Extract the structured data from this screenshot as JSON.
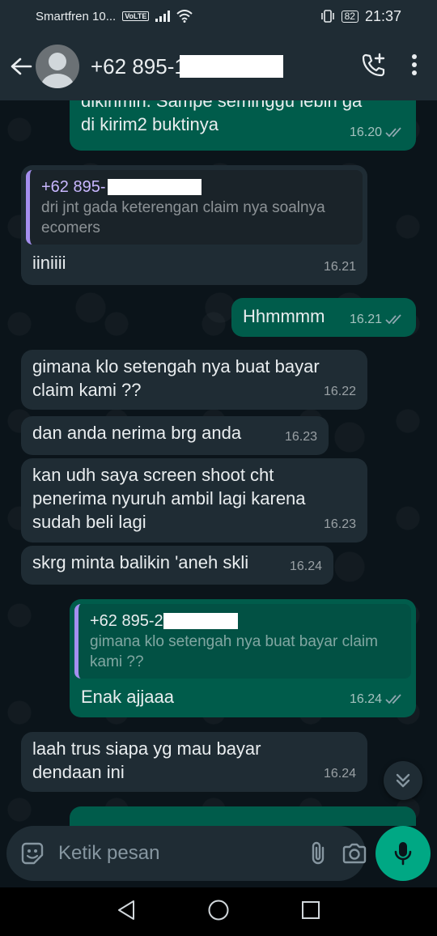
{
  "status_bar": {
    "carrier": "Smartfren 10...",
    "volte": "VoLTE",
    "battery": "82",
    "time": "21:37"
  },
  "header": {
    "contact_prefix": "+62 895-1"
  },
  "messages": [
    {
      "dir": "out",
      "text": "dikirimin. Sampe seminggu lebih ga\ndi kirim2 buktinya",
      "time": "16.20"
    },
    {
      "dir": "in",
      "quote_name": "+62 895-",
      "quote_text": "dri jnt gada keterengan claim nya soalnya ecomers",
      "text": "iiniiii",
      "time": "16.21"
    },
    {
      "dir": "out",
      "text": "Hhmmmm",
      "time": "16.21"
    },
    {
      "dir": "in",
      "text": "gimana klo setengah nya buat bayar claim kami ??",
      "time": "16.22"
    },
    {
      "dir": "in",
      "text": "dan anda nerima brg anda",
      "time": "16.23"
    },
    {
      "dir": "in",
      "text": "kan udh saya screen shoot cht penerima nyuruh ambil lagi karena sudah beli lagi",
      "time": "16.23"
    },
    {
      "dir": "in",
      "text": "skrg minta balikin 'aneh skli",
      "time": "16.24"
    },
    {
      "dir": "out",
      "quote_name": "+62 895-2",
      "quote_text": "gimana klo setengah nya buat bayar claim kami ??",
      "text": "Enak ajjaaa",
      "time": "16.24"
    },
    {
      "dir": "in",
      "text": "laah trus siapa yg mau bayar dendaan ini",
      "time": "16.24"
    }
  ],
  "input": {
    "placeholder": "Ketik pesan"
  },
  "icons": {
    "back": "arrow-left-icon",
    "call": "add-call-icon",
    "menu": "more-vert-icon",
    "emoji": "emoji-icon",
    "attach": "paperclip-icon",
    "camera": "camera-icon",
    "mic": "mic-icon",
    "scroll": "double-chevron-down-icon"
  },
  "colors": {
    "accent": "#00a884",
    "outgoing_bubble": "#005c4b",
    "incoming_bubble": "#1f2c34",
    "quote_bar": "#a58ff0",
    "read_check": "#8fa8b0"
  }
}
